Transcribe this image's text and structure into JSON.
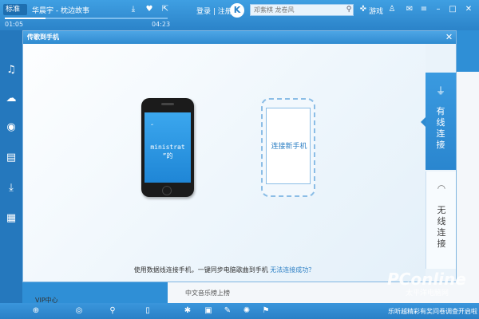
{
  "topbar": {
    "mode": "标准",
    "now_playing": "华晨宇 - 枕边故事",
    "time_current": "01:05",
    "time_total": "04:23",
    "progress": 0.25,
    "login": "登录 | 注册",
    "logo": "K",
    "search_text": "邓紫棋 龙卷风",
    "game": "游戏",
    "icons": [
      "download-icon",
      "heart-icon",
      "share-icon",
      "search-icon",
      "gamepad-icon",
      "tshirt-icon",
      "mail-icon",
      "menu-icon",
      "minimize-icon",
      "maximize-icon",
      "close-icon"
    ]
  },
  "sidebar": {
    "icons": [
      "music-note-icon",
      "cloud-icon",
      "radio-icon",
      "notes-icon",
      "download-icon",
      "apps-icon"
    ],
    "vip": "VIP中心"
  },
  "dialog": {
    "title": "传歌到手机",
    "phone_glyph": "“",
    "phone_text": "ministrat\n”的",
    "new_phone_label": "连接新手机",
    "help_text": "使用数据线连接手机，一键同步电脑歌曲到手机 ",
    "help_link": "无法连接成功？"
  },
  "tabs": [
    {
      "label": "有\n线\n连\n接",
      "icon": "usb-icon",
      "active": true
    },
    {
      "label": "无\n线\n连\n接",
      "icon": "wifi-icon",
      "active": false
    }
  ],
  "background": {
    "list_item": "中文音乐榜上榜",
    "watermark": "PConline",
    "watermark_sub": "太平洋电脑网"
  },
  "bottombar": {
    "icons": [
      "add-icon",
      "locate-icon",
      "search-icon",
      "phone-icon"
    ],
    "ad": "乐听越精彩有奖问卷调查开启啦"
  }
}
